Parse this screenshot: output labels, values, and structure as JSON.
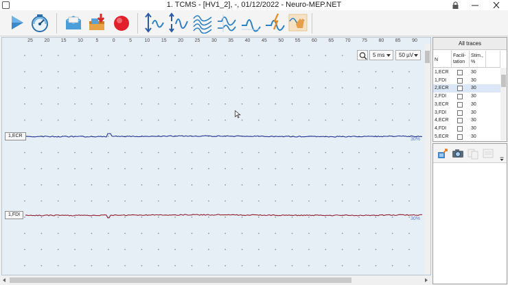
{
  "window": {
    "title": "1. TCMS - [HV1_2], -, 01/12/2022 - Neuro-MEP.NET"
  },
  "toolbar": {
    "buttons": [
      {
        "name": "play-icon"
      },
      {
        "name": "gauge-icon"
      },
      {
        "name": "open-file-icon"
      },
      {
        "name": "save-download-icon"
      },
      {
        "name": "record-icon"
      },
      {
        "name": "move-traces-up-down-icon"
      },
      {
        "name": "scale-traces-icon"
      },
      {
        "name": "overlay-traces-icon"
      },
      {
        "name": "waveform-markers-icon"
      },
      {
        "name": "waveform-icon"
      },
      {
        "name": "stimulus-waveform-icon"
      },
      {
        "name": "hand-waveform-icon"
      }
    ]
  },
  "plot": {
    "ruler_ticks": [
      "25",
      "20",
      "15",
      "10",
      "5",
      "0",
      "5",
      "10",
      "15",
      "20",
      "25",
      "30",
      "35",
      "40",
      "45",
      "50",
      "55",
      "60",
      "65",
      "70",
      "75",
      "80",
      "85",
      "90"
    ],
    "timebase": "5 ms",
    "sensitivity": "50 µV",
    "channels": [
      {
        "label": "1,ECR",
        "color": "#1f2f8c",
        "percent": "30%"
      },
      {
        "label": "1,FDI",
        "color": "#8e1b2a",
        "percent": "30%"
      }
    ]
  },
  "traces_panel": {
    "title": "All traces",
    "columns": {
      "n": "N",
      "facilitation": "Facili-\ntation",
      "stim": "Stim.,\n%"
    },
    "rows": [
      {
        "n": "1,ECR",
        "stim": "30",
        "selected": false
      },
      {
        "n": "1,FDI",
        "stim": "30",
        "selected": false
      },
      {
        "n": "2,ECR",
        "stim": "30",
        "selected": true
      },
      {
        "n": "2,FDI",
        "stim": "30",
        "selected": false
      },
      {
        "n": "3,ECR",
        "stim": "30",
        "selected": false
      },
      {
        "n": "3,FDI",
        "stim": "30",
        "selected": false
      },
      {
        "n": "4,ECR",
        "stim": "30",
        "selected": false
      },
      {
        "n": "4,FDI",
        "stim": "30",
        "selected": false
      },
      {
        "n": "5,ECR",
        "stim": "30",
        "selected": false
      }
    ]
  },
  "tools_panel": {
    "buttons": [
      "export-icon",
      "camera-icon",
      "copy-disabled-icon",
      "list-disabled-icon"
    ]
  }
}
